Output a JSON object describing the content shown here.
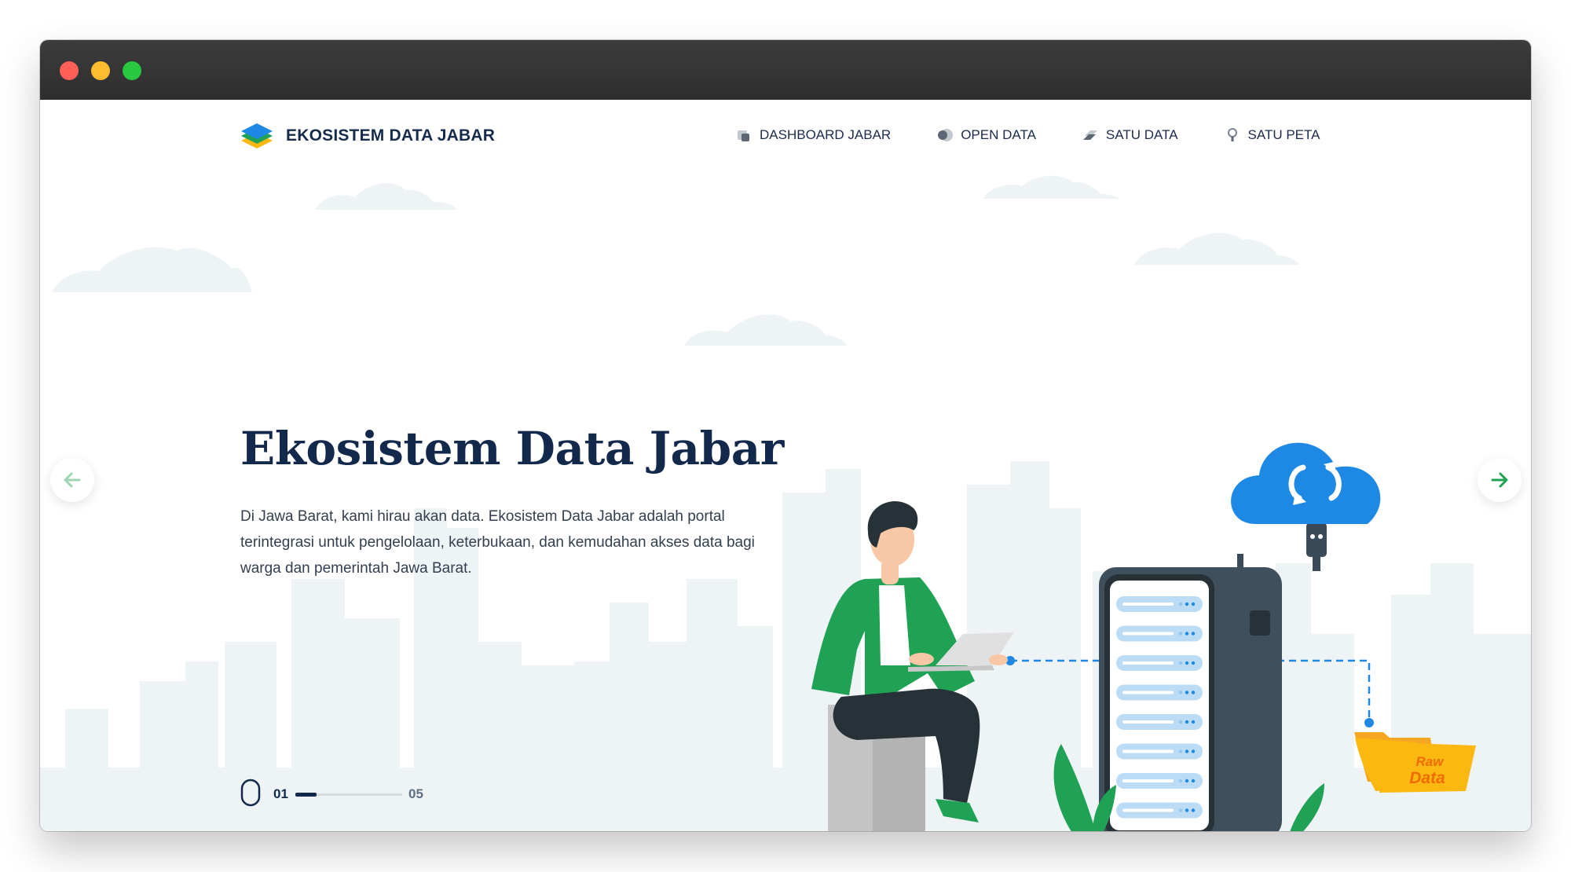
{
  "brand": {
    "name": "EKOSISTEM DATA JABAR"
  },
  "nav": {
    "items": [
      {
        "label": "DASHBOARD JABAR",
        "icon": "dashboard-icon"
      },
      {
        "label": "OPEN DATA",
        "icon": "open-data-icon"
      },
      {
        "label": "SATU DATA",
        "icon": "satu-data-icon"
      },
      {
        "label": "SATU PETA",
        "icon": "satu-peta-icon"
      }
    ]
  },
  "hero": {
    "title": "Ekosistem Data Jabar",
    "description": "Di Jawa Barat, kami hirau akan data. Ekosistem Data Jabar adalah portal terintegrasi untuk pengelolaan, keterbukaan, dan kemudahan akses data bagi warga dan pemerintah Jawa Barat."
  },
  "illustration": {
    "folder_label_line1": "Raw",
    "folder_label_line2": "Data"
  },
  "slider": {
    "current": "01",
    "total": "05",
    "progress": 0.2
  },
  "colors": {
    "navy": "#13294b",
    "green": "#1fa255",
    "blue": "#1e88e5",
    "yellow": "#fbb811",
    "background_shapes": "#eef3f6"
  }
}
